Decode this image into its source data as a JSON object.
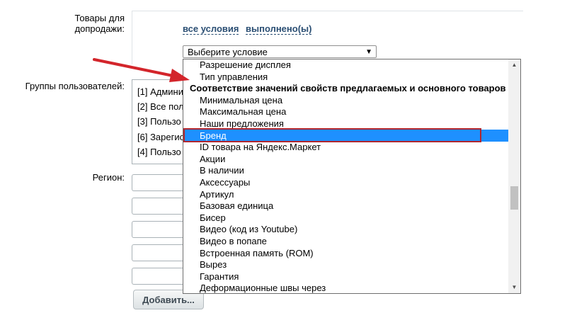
{
  "labels": {
    "upsell": "Товары для допродажи:",
    "user_groups": "Группы пользователей:",
    "region": "Регион:"
  },
  "conditions": {
    "all_label": "все условия",
    "done_label": "выполнено(ы)"
  },
  "select": {
    "value": "Выберите условие",
    "arrow": "▼"
  },
  "groups": [
    "[1] Админи",
    "[2] Все пол",
    "[3] Пользо",
    "[6] Зарегис",
    "[4] Пользо"
  ],
  "add_button_label": "Добавить...",
  "dropdown": {
    "options": [
      {
        "label": "Разрешение дисплея",
        "type": "option"
      },
      {
        "label": "Тип управления",
        "type": "option"
      },
      {
        "label": "Соответствие значений свойств предлагаемых и основного товаров",
        "type": "group"
      },
      {
        "label": "Минимальная цена",
        "type": "option"
      },
      {
        "label": "Максимальная цена",
        "type": "option"
      },
      {
        "label": "Наши предложения",
        "type": "option"
      },
      {
        "label": "Бренд",
        "type": "option",
        "selected": true
      },
      {
        "label": "ID товара на Яндекс.Маркет",
        "type": "option"
      },
      {
        "label": "Акции",
        "type": "option"
      },
      {
        "label": "В наличии",
        "type": "option"
      },
      {
        "label": "Аксессуары",
        "type": "option"
      },
      {
        "label": "Артикул",
        "type": "option"
      },
      {
        "label": "Базовая единица",
        "type": "option"
      },
      {
        "label": "Бисер",
        "type": "option"
      },
      {
        "label": "Видео (код из Youtube)",
        "type": "option"
      },
      {
        "label": "Видео в попапе",
        "type": "option"
      },
      {
        "label": "Встроенная память (ROM)",
        "type": "option"
      },
      {
        "label": "Вырез",
        "type": "option"
      },
      {
        "label": "Гарантия",
        "type": "option"
      },
      {
        "label": "Деформационные швы через",
        "type": "option"
      }
    ],
    "scroll_up_icon": "▲",
    "scroll_down_icon": "▼",
    "selected_color": "#1e90ff",
    "highlight_color": "#b0262e"
  },
  "annotation": {
    "arrow_color": "#d3252b"
  }
}
